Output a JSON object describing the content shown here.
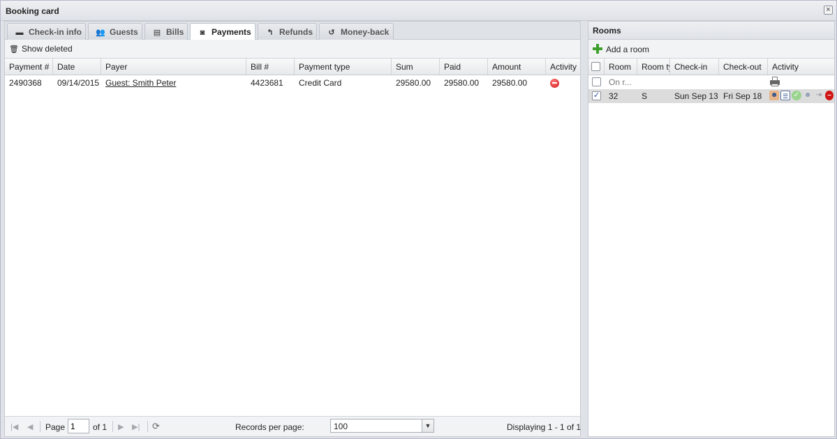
{
  "window": {
    "title": "Booking card"
  },
  "tabs": [
    {
      "label": "Check-in info",
      "icon": "briefcase-icon",
      "glyph": "▬"
    },
    {
      "label": "Guests",
      "icon": "users-icon",
      "glyph": "👥"
    },
    {
      "label": "Bills",
      "icon": "document-icon",
      "glyph": "▤"
    },
    {
      "label": "Payments",
      "icon": "banknote-icon",
      "glyph": "◙"
    },
    {
      "label": "Refunds",
      "icon": "reply-icon",
      "glyph": "↰"
    },
    {
      "label": "Money-back",
      "icon": "undo-icon",
      "glyph": "↺"
    }
  ],
  "active_tab": "Payments",
  "toolbar": {
    "show_deleted": "Show deleted"
  },
  "payments_table": {
    "columns": [
      "Payment #",
      "Date",
      "Payer",
      "Bill #",
      "Payment type",
      "Sum",
      "Paid",
      "Amount",
      "Activity"
    ],
    "rows": [
      {
        "payment_no": "2490368",
        "date": "09/14/2015",
        "payer": "Guest: Smith Peter",
        "bill_no": "4423681",
        "payment_type": "Credit Card",
        "sum": "29580.00",
        "paid": "29580.00",
        "amount": "29580.00"
      }
    ]
  },
  "pager": {
    "page_label": "Page",
    "page_value": "1",
    "of_label": "of 1",
    "records_per_page_label": "Records per page:",
    "records_per_page_value": "100",
    "displaying": "Displaying 1 - 1 of 1"
  },
  "rooms": {
    "title": "Rooms",
    "add_label": "Add a room",
    "columns": [
      "Room",
      "Room ty",
      "Check-in",
      "Check-out",
      "Activity"
    ],
    "rows": [
      {
        "room": "On r...",
        "room_type": "",
        "check_in": "",
        "check_out": "",
        "checked": false
      },
      {
        "room": "32",
        "room_type": "S",
        "check_in": "Sun Sep 13",
        "check_out": "Fri Sep 18",
        "checked": true
      }
    ]
  },
  "colors": {
    "accent_green": "#3ca02a",
    "delete_red": "#d01515",
    "header_bg": "#e8e9eb"
  }
}
